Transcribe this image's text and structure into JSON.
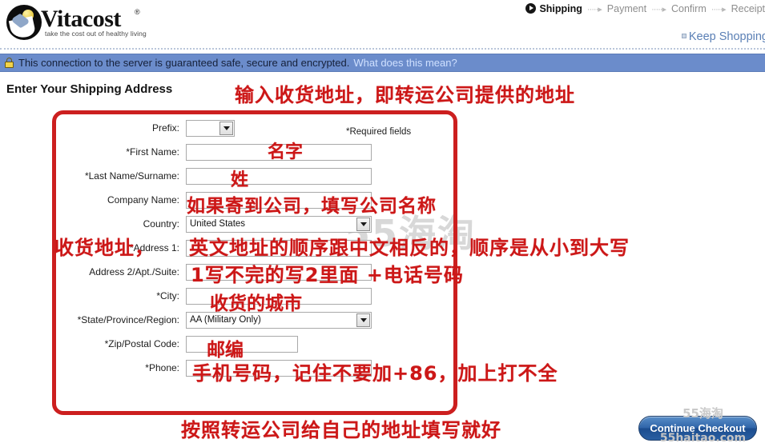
{
  "brand": {
    "name": "Vitacost",
    "registered": "®",
    "tagline": "take the cost out of healthy living"
  },
  "checkout_steps": [
    {
      "label": "Shipping",
      "active": true
    },
    {
      "label": "Payment",
      "active": false
    },
    {
      "label": "Confirm",
      "active": false
    },
    {
      "label": "Receipt",
      "active": false
    }
  ],
  "header": {
    "keep_shopping": "Keep Shopping"
  },
  "secure_bar": {
    "message": "This connection to the server is guaranteed safe, secure and encrypted.",
    "link": "What does this mean?",
    "background_color": "#6b8ccb",
    "lock_color": "#f2d34a"
  },
  "page_title": "Enter Your Shipping Address",
  "required_note": "*Required fields",
  "form": {
    "fields": [
      {
        "label": "Prefix:",
        "type": "select",
        "value": "",
        "width": "prefix"
      },
      {
        "label": "*First Name:",
        "type": "text",
        "value": "",
        "width": "text"
      },
      {
        "label": "*Last Name/Surname:",
        "type": "text",
        "value": "",
        "width": "text"
      },
      {
        "label": "Company Name:",
        "type": "text",
        "value": "",
        "width": "text"
      },
      {
        "label": "Country:",
        "type": "select",
        "value": "United States",
        "width": "sel"
      },
      {
        "label": "*Address 1:",
        "type": "text",
        "value": "",
        "width": "text"
      },
      {
        "label": "Address 2/Apt./Suite:",
        "type": "text",
        "value": "",
        "width": "text"
      },
      {
        "label": "*City:",
        "type": "text",
        "value": "",
        "width": "text"
      },
      {
        "label": "*State/Province/Region:",
        "type": "select",
        "value": "AA (Military Only)",
        "width": "sel"
      },
      {
        "label": "*Zip/Postal Code:",
        "type": "text",
        "value": "",
        "width": "zip"
      },
      {
        "label": "*Phone:",
        "type": "text",
        "value": "",
        "width": "text"
      }
    ]
  },
  "annotations": {
    "color": "#cc1717",
    "top": "输入收货地址，即转运公司提供的地址",
    "first_name": "名字",
    "last_name": "姓",
    "company": "如果寄到公司，填写公司名称",
    "address1_left": "收货地址，",
    "address1_right": "英文地址的顺序跟中文相反的，顺序是从小到大写",
    "address2": "1写不完的写2里面 +电话号码",
    "city": "收货的城市",
    "zip": "邮编",
    "phone": "手机号码，记住不要加+86，加上打不全",
    "bottom": "按照转运公司给自己的地址填写就好"
  },
  "watermark": {
    "center": "55海淘",
    "button_line1": "55海淘",
    "button_line2": "55haitao.com"
  },
  "continue_button": {
    "label": "Continue Checkout",
    "color": "#2f64a8"
  }
}
